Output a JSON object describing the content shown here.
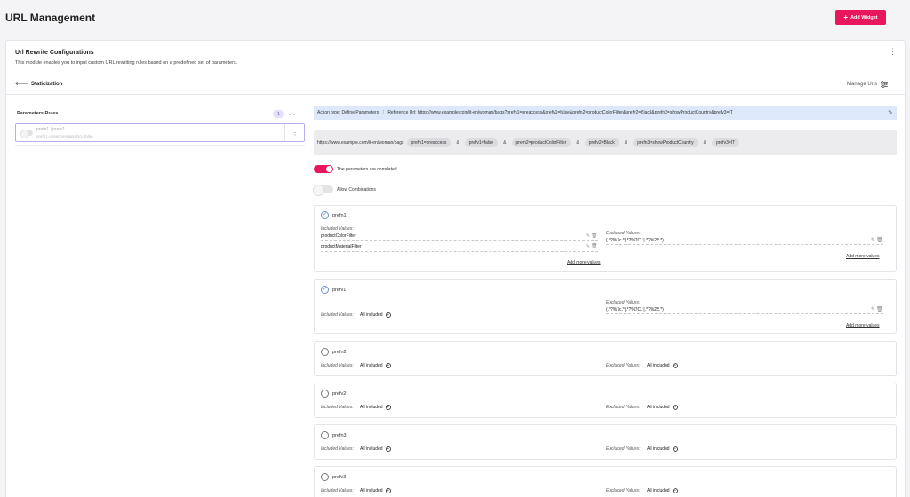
{
  "header": {
    "title": "URL Management",
    "add_widget_label": "Add Widget"
  },
  "module": {
    "title": "Url Rewrite Configurations",
    "subtitle": "This module enables you to input custom URL rewriting rules based on a predefined set of parameters.",
    "section_label": "Staticization",
    "manage_label": "Manage Urls"
  },
  "rules": {
    "heading": "Parameters Rules",
    "count": "1",
    "items": [
      {
        "name": "prefn1 | prefv1",
        "desc": "prefn1=preaccess&prefv1=false"
      }
    ]
  },
  "info": {
    "action_type_label": "Action type:",
    "action_type_value": "Define Parameters",
    "reference_label": "Reference Url:",
    "reference_value": "https://www.example.com/it-en/woman/bags?prefn1=preaccess&prefv1=false&prefn2=productColorFilter&prefv2=Black&prefn3=showProductCountry&prefv3=IT"
  },
  "url_builder": {
    "base": "https://www.example.com/it-en/woman/bags",
    "params": [
      "prefn1=preaccess",
      "prefv1=false",
      "prefn2=productColorFilter",
      "prefv2=Black",
      "prefn3=showProductCountry",
      "prefv3=IT"
    ],
    "separator": "&"
  },
  "toggles": {
    "correlated_label": "The parameters are correlated",
    "correlated_on": true,
    "combinations_label": "Allow Combinations",
    "combinations_on": false
  },
  "param_cards": [
    {
      "name": "prefn1",
      "checked": true,
      "included_label": "Included Values:",
      "included_values": [
        "productColorFilter",
        "productMaterialFilter"
      ],
      "excluded_label": "Excluded Values:",
      "excluded_values": [
        "(.*?%7c.*|.*?%7C.*|.*?%25.*)"
      ],
      "add_more": "Add more values"
    },
    {
      "name": "prefv1",
      "checked": true,
      "included_label": "Included Values:",
      "included_all": "All included",
      "excluded_label": "Excluded Values:",
      "excluded_values": [
        "(.*?%7c.*|.*?%7C.*|.*?%25.*)"
      ],
      "add_more": "Add more values"
    },
    {
      "name": "prefn2",
      "checked": false,
      "included_label": "Included Values:",
      "included_all": "All included",
      "excluded_label": "Excluded Values:",
      "excluded_all": "All included"
    },
    {
      "name": "prefv2",
      "checked": false,
      "included_label": "Included Values:",
      "included_all": "All included",
      "excluded_label": "Excluded Values:",
      "excluded_all": "All included"
    },
    {
      "name": "prefn3",
      "checked": false,
      "included_label": "Included Values:",
      "included_all": "All included",
      "excluded_label": "Excluded Values:",
      "excluded_all": "All included"
    },
    {
      "name": "prefv3",
      "checked": false,
      "included_label": "Included Values:",
      "included_all": "All included",
      "excluded_label": "Excluded Values:",
      "excluded_all": "All included"
    }
  ],
  "colors": {
    "accent": "#e8175d",
    "info_bg": "#dde9fa",
    "badge": "#e5dff7"
  }
}
